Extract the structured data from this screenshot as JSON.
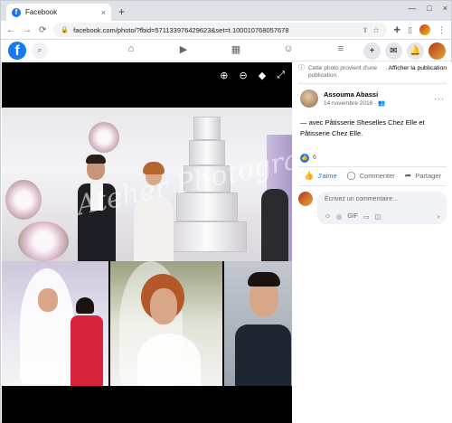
{
  "browser": {
    "tab_title": "Facebook",
    "tab_close": "×",
    "new_tab": "+",
    "window_controls": [
      "—",
      "□",
      "×"
    ],
    "nav_buttons": [
      "←",
      "→",
      "⟳"
    ],
    "url": "facebook.com/photo/?fbid=571133976429623&set=t.100010768057678",
    "url_lock": "🔒",
    "omni_actions": [
      "⇪",
      "☆"
    ],
    "ext_icons": [
      "puzzle-icon",
      "sidepanel-icon"
    ],
    "menu": "⋮"
  },
  "fb_nav": {
    "logo": "f",
    "search_icon": "search-icon",
    "nav_items": [
      {
        "name": "home-icon",
        "glyph": "⌂"
      },
      {
        "name": "watch-icon",
        "glyph": "▶"
      },
      {
        "name": "marketplace-icon",
        "glyph": "▦"
      },
      {
        "name": "groups-icon",
        "glyph": "☺"
      },
      {
        "name": "menu-icon",
        "glyph": "≡"
      }
    ],
    "right_items": [
      {
        "name": "create-icon",
        "glyph": "+"
      },
      {
        "name": "messenger-icon",
        "glyph": "✉"
      },
      {
        "name": "notifications-icon",
        "glyph": "🔔"
      }
    ]
  },
  "photo_tools": [
    {
      "name": "zoom-in-icon",
      "glyph": "⊕"
    },
    {
      "name": "zoom-out-icon",
      "glyph": "⊖"
    },
    {
      "name": "tag-icon",
      "glyph": "◆"
    },
    {
      "name": "fullscreen-icon",
      "glyph": "⤢"
    }
  ],
  "watermark": "Ateher Photography",
  "panel": {
    "provenance_text": "Cette photo provient d'une publication.",
    "provenance_link": "Afficher la publication",
    "author_name": "Assouma Abassi",
    "post_date": "14 novembre 2016 · 👥",
    "more": "···",
    "caption_prefix": "— avec",
    "caption_tag1": "Pâtisserie Sheselles Chez Elle",
    "caption_mid": "et",
    "caption_tag2": "Pâtisserie Chez Elle.",
    "reaction_count": "6",
    "actions": {
      "like": "J'aime",
      "comment": "Commenter",
      "share": "Partager"
    },
    "comment_placeholder": "Écrivez un commentaire…",
    "comment_tools": [
      "☺",
      "◎",
      "GIF",
      "▭",
      "◫"
    ],
    "send": "➤"
  }
}
